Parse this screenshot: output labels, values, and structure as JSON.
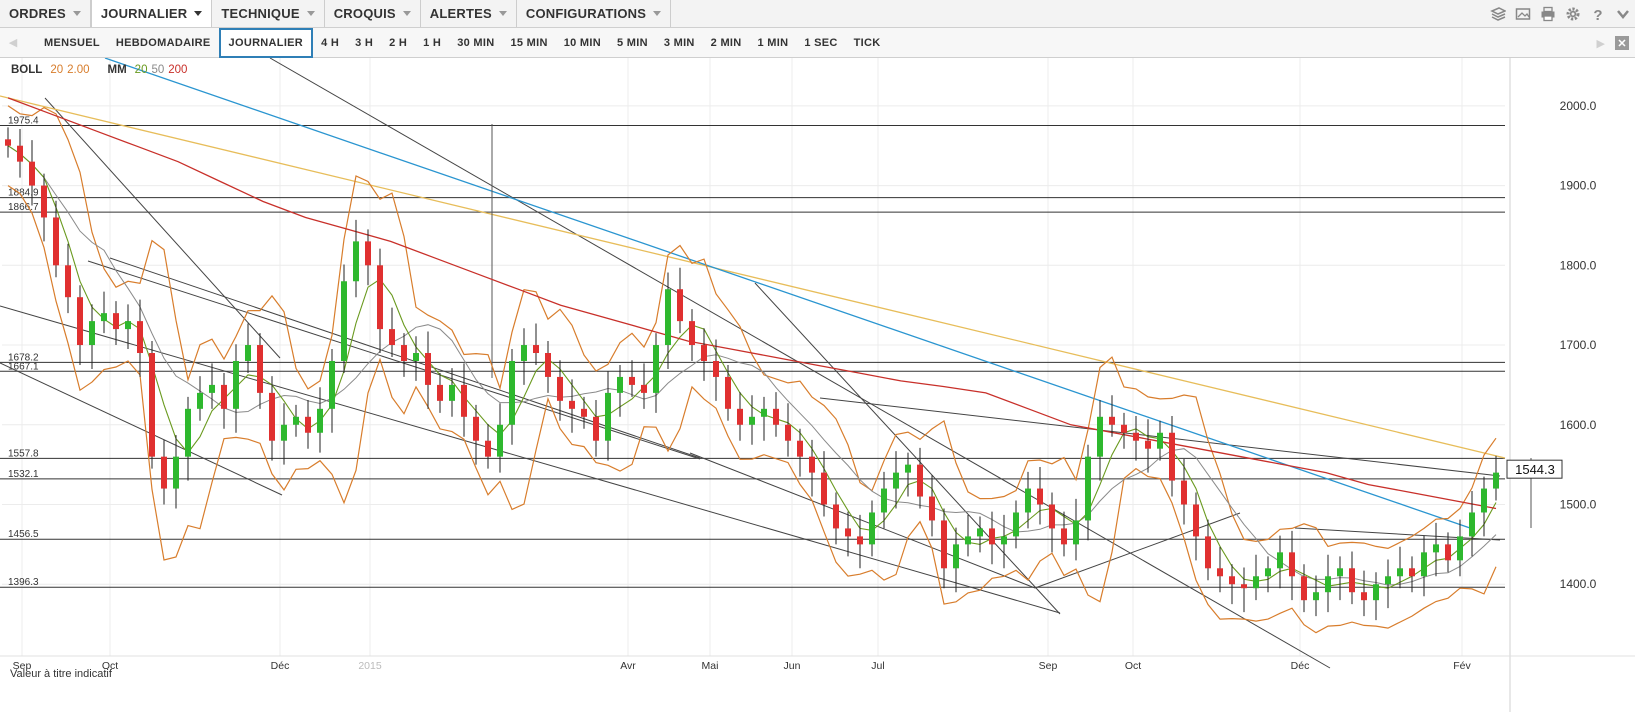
{
  "menu": [
    {
      "label": "ORDRES",
      "active": false
    },
    {
      "label": "JOURNALIER",
      "active": true
    },
    {
      "label": "TECHNIQUE",
      "active": false
    },
    {
      "label": "CROQUIS",
      "active": false
    },
    {
      "label": "ALERTES",
      "active": false
    },
    {
      "label": "CONFIGURATIONS",
      "active": false
    }
  ],
  "toolbar_icons": [
    "layers-icon",
    "image-icon",
    "print-icon",
    "gear-icon",
    "help-icon",
    "more-icon"
  ],
  "timeframes": {
    "items": [
      "MENSUEL",
      "HEBDOMADAIRE",
      "JOURNALIER",
      "4 H",
      "3 H",
      "2 H",
      "1 H",
      "30 MIN",
      "15 MIN",
      "10 MIN",
      "5 MIN",
      "3 MIN",
      "2 MIN",
      "1 MIN",
      "1 SEC",
      "TICK"
    ],
    "active": "JOURNALIER"
  },
  "legend": {
    "boll_label": "BOLL",
    "boll_period": "20",
    "boll_dev": "2.00",
    "mm_label": "MM",
    "mm_periods": [
      "20",
      "50",
      "200"
    ]
  },
  "note": "Valeur à titre indicatif",
  "colors": {
    "candle_up": "#2eb82e",
    "candle_down": "#e03030",
    "boll": "#d87d2c",
    "mm20": "#6a9a1f",
    "mm50": "#8a8a8a",
    "mm200": "#c8302a",
    "trend_blue": "#2a95d0",
    "trend_yellow": "#e7bd5a",
    "trend_dark": "#444444",
    "price_tag_border": "#333333"
  },
  "chart_data": {
    "type": "candlestick",
    "y_axis_ticks": [
      "2000.0",
      "1900.0",
      "1800.0",
      "1700.0",
      "1600.0",
      "1500.0",
      "1400.0"
    ],
    "y_axis_values": [
      2000,
      1900,
      1800,
      1700,
      1600,
      1500,
      1400
    ],
    "ylim": [
      1310,
      2060
    ],
    "x_axis_labels": [
      "Sep",
      "Oct",
      "Déc",
      "2015",
      "Avr",
      "Mai",
      "Jun",
      "Jul",
      "Sep",
      "Oct",
      "Déc",
      "Fév"
    ],
    "current_price": "1544.3",
    "horizontal_levels": [
      {
        "value": 1975.4,
        "label": "1975.4"
      },
      {
        "value": 1884.9,
        "label": "1884.9"
      },
      {
        "value": 1866.7,
        "label": "1866.7"
      },
      {
        "value": 1678.2,
        "label": "1678.2"
      },
      {
        "value": 1667.1,
        "label": "1667.1"
      },
      {
        "value": 1557.8,
        "label": "1557.8"
      },
      {
        "value": 1532.1,
        "label": "1532.1"
      },
      {
        "value": 1456.5,
        "label": "1456.5"
      },
      {
        "value": 1396.3,
        "label": "1396.3"
      }
    ],
    "close_path": [
      1950,
      1930,
      1900,
      1860,
      1800,
      1760,
      1700,
      1730,
      1740,
      1720,
      1730,
      1690,
      1560,
      1520,
      1560,
      1620,
      1640,
      1650,
      1620,
      1680,
      1700,
      1640,
      1580,
      1600,
      1610,
      1590,
      1620,
      1680,
      1780,
      1830,
      1800,
      1720,
      1700,
      1680,
      1690,
      1650,
      1630,
      1650,
      1610,
      1580,
      1560,
      1600,
      1680,
      1700,
      1690,
      1660,
      1630,
      1620,
      1610,
      1580,
      1640,
      1660,
      1650,
      1640,
      1700,
      1770,
      1730,
      1700,
      1680,
      1660,
      1620,
      1600,
      1610,
      1620,
      1600,
      1580,
      1560,
      1540,
      1500,
      1470,
      1460,
      1450,
      1490,
      1520,
      1540,
      1550,
      1510,
      1480,
      1420,
      1450,
      1460,
      1470,
      1450,
      1460,
      1490,
      1520,
      1500,
      1470,
      1450,
      1480,
      1560,
      1610,
      1600,
      1590,
      1580,
      1570,
      1590,
      1530,
      1500,
      1460,
      1420,
      1410,
      1400,
      1395,
      1410,
      1420,
      1440,
      1410,
      1380,
      1390,
      1410,
      1420,
      1390,
      1380,
      1400,
      1410,
      1420,
      1410,
      1440,
      1450,
      1430,
      1460,
      1490,
      1520,
      1540
    ],
    "close_path_note": "",
    "mm200_path": [
      2010,
      1990,
      1970,
      1950,
      1930,
      1905,
      1880,
      1860,
      1845,
      1830,
      1810,
      1790,
      1770,
      1750,
      1735,
      1720,
      1705,
      1695,
      1685,
      1675,
      1665,
      1655,
      1648,
      1640,
      1620,
      1600,
      1590,
      1580,
      1570,
      1560,
      1550,
      1540,
      1525,
      1515,
      1505,
      1495
    ]
  }
}
